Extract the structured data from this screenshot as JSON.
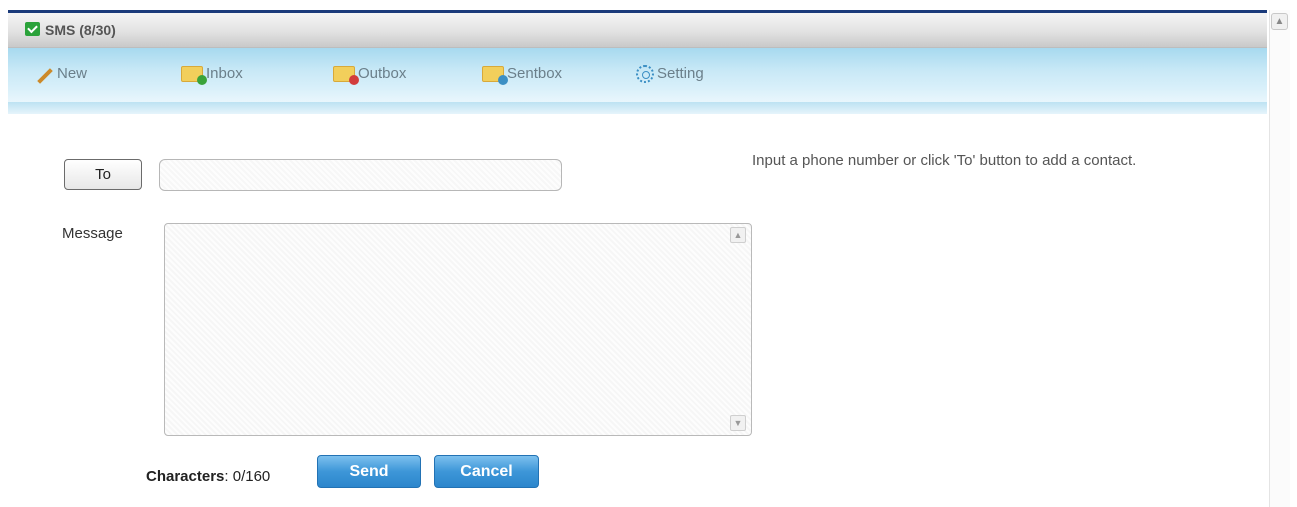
{
  "header": {
    "title": "SMS (8/30)"
  },
  "nav": {
    "items": [
      {
        "label": "New",
        "icon": "pencil-icon"
      },
      {
        "label": "Inbox",
        "icon": "inbox-folder-icon"
      },
      {
        "label": "Outbox",
        "icon": "outbox-folder-icon"
      },
      {
        "label": "Sentbox",
        "icon": "sentbox-folder-icon"
      },
      {
        "label": "Setting",
        "icon": "gear-icon"
      }
    ]
  },
  "form": {
    "to_button": "To",
    "to_value": "",
    "hint": "Input a phone number or click 'To' button to add a contact.",
    "message_label": "Message",
    "message_value": "",
    "characters_label": "Characters",
    "characters_count": ": 0/160",
    "send_label": "Send",
    "cancel_label": "Cancel"
  },
  "colors": {
    "accent": "#3d96d8",
    "nav_bg": "#c7e8f6",
    "title_icon": "#2aa23a"
  }
}
